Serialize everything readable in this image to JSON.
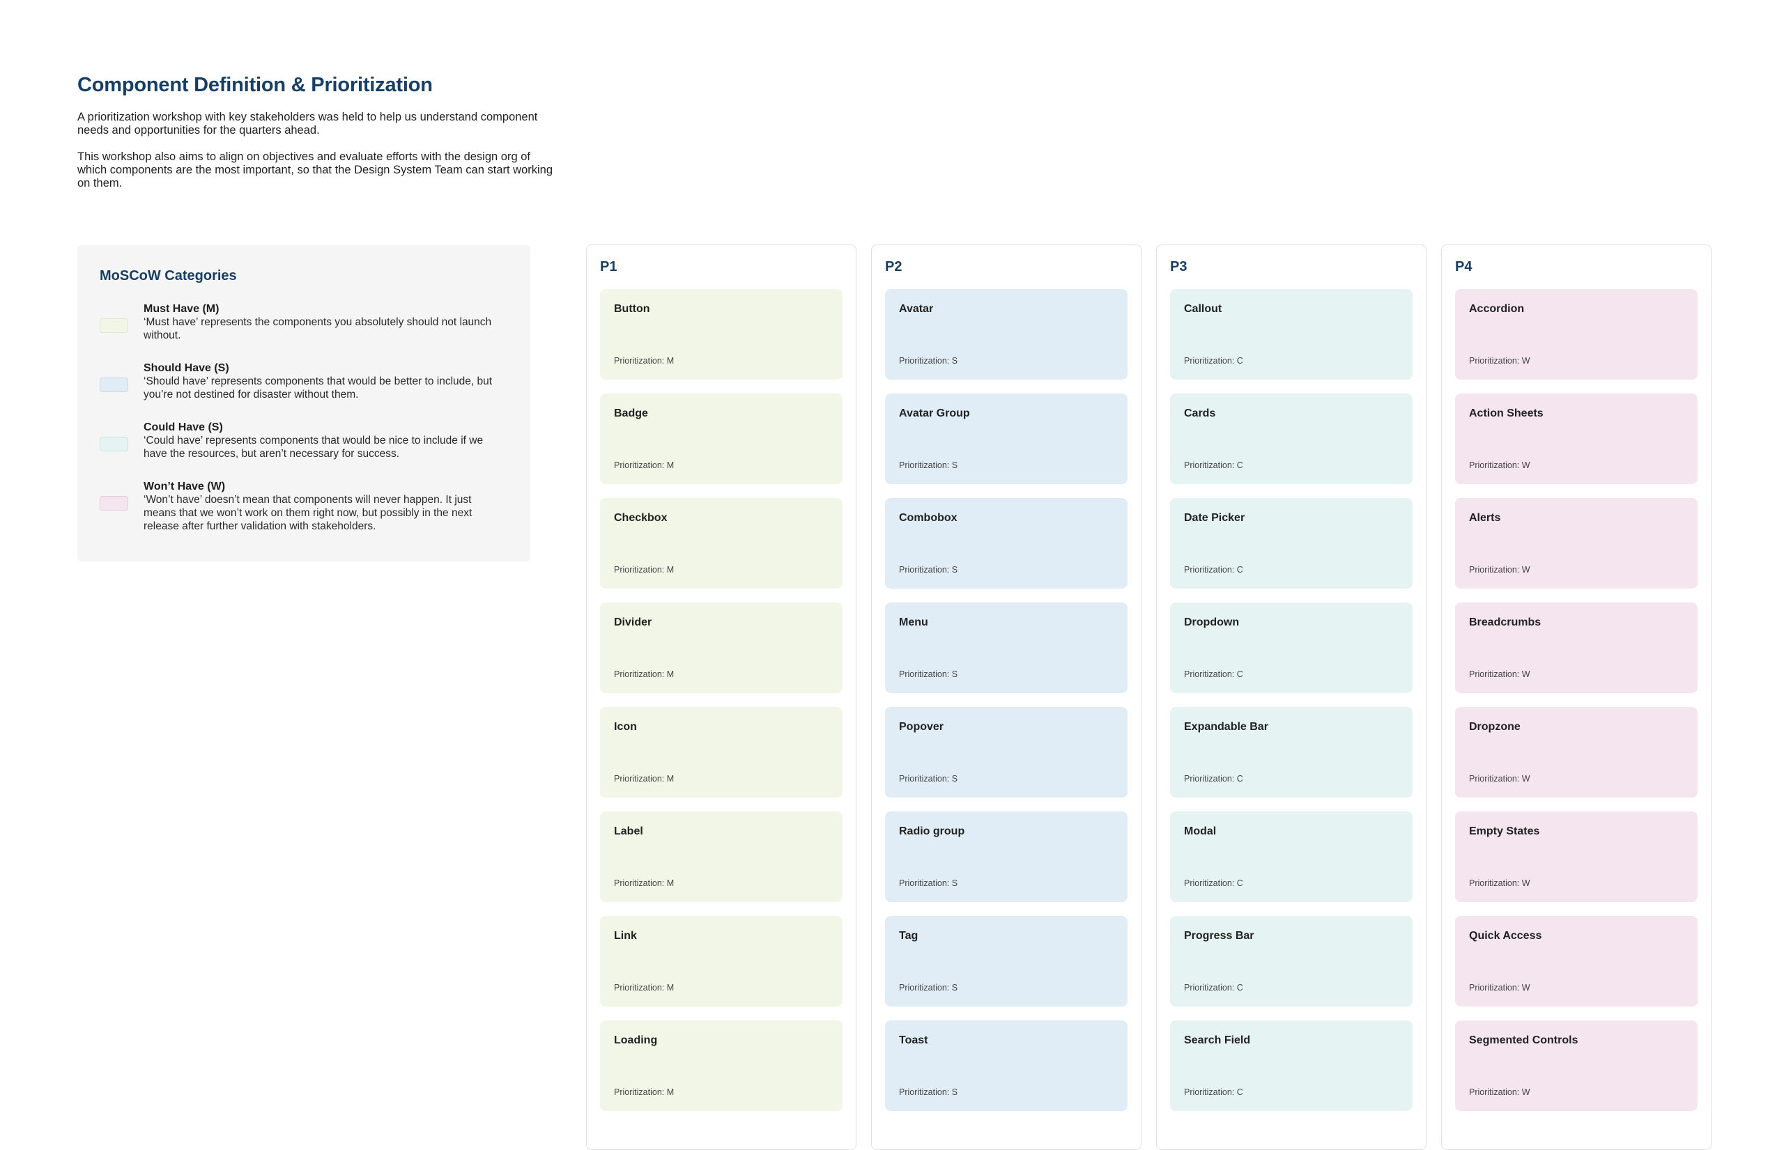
{
  "page": {
    "title": "Component Definition & Prioritization",
    "intro": [
      "A prioritization workshop with key stakeholders was held to help us understand component needs and opportunities for the quarters ahead.",
      "This workshop also aims to align on objectives and evaluate efforts with the design org of which components are the most important, so that the Design System Team can start working on them."
    ]
  },
  "legend": {
    "title": "MoSCoW Categories",
    "items": [
      {
        "name": "Must Have (M)",
        "description": "‘Must have’ represents the components you absolutely should not launch without.",
        "color": "#f2f6e6",
        "border": "#dfe8c8"
      },
      {
        "name": "Should Have (S)",
        "description": "‘Should have’ represents components that would be better to include, but you’re not destined for disaster without them.",
        "color": "#e1edf6",
        "border": "#c8dbeb"
      },
      {
        "name": "Could Have (S)",
        "description": "‘Could have’ represents components that would be nice to include if we have the resources, but aren’t necessary for success.",
        "color": "#e5f4f3",
        "border": "#c9e5e3"
      },
      {
        "name": "Won’t Have (W)",
        "description": "‘Won’t have’ doesn’t mean that components will never happen. It just means that we won’t work on them right now, but possibly in the next release after further validation with stakeholders.",
        "color": "#f4e5ee",
        "border": "#e6cbdb"
      }
    ]
  },
  "columns": [
    {
      "title": "P1",
      "color": "#f2f6e6",
      "cards": [
        {
          "name": "Button",
          "priority": "Prioritization: M"
        },
        {
          "name": "Badge",
          "priority": "Prioritization: M"
        },
        {
          "name": "Checkbox",
          "priority": "Prioritization: M"
        },
        {
          "name": "Divider",
          "priority": "Prioritization: M"
        },
        {
          "name": "Icon",
          "priority": "Prioritization: M"
        },
        {
          "name": "Label",
          "priority": "Prioritization: M"
        },
        {
          "name": "Link",
          "priority": "Prioritization: M"
        },
        {
          "name": "Loading",
          "priority": "Prioritization: M"
        }
      ]
    },
    {
      "title": "P2",
      "color": "#e1edf6",
      "cards": [
        {
          "name": "Avatar",
          "priority": "Prioritization: S"
        },
        {
          "name": "Avatar Group",
          "priority": "Prioritization: S"
        },
        {
          "name": "Combobox",
          "priority": "Prioritization: S"
        },
        {
          "name": "Menu",
          "priority": "Prioritization: S"
        },
        {
          "name": "Popover",
          "priority": "Prioritization: S"
        },
        {
          "name": "Radio group",
          "priority": "Prioritization: S"
        },
        {
          "name": "Tag",
          "priority": "Prioritization: S"
        },
        {
          "name": "Toast",
          "priority": "Prioritization: S"
        }
      ]
    },
    {
      "title": "P3",
      "color": "#e5f4f3",
      "cards": [
        {
          "name": "Callout",
          "priority": "Prioritization: C"
        },
        {
          "name": "Cards",
          "priority": "Prioritization: C"
        },
        {
          "name": "Date Picker",
          "priority": "Prioritization: C"
        },
        {
          "name": "Dropdown",
          "priority": "Prioritization: C"
        },
        {
          "name": "Expandable Bar",
          "priority": "Prioritization: C"
        },
        {
          "name": "Modal",
          "priority": "Prioritization: C"
        },
        {
          "name": "Progress Bar",
          "priority": "Prioritization: C"
        },
        {
          "name": "Search Field",
          "priority": "Prioritization: C"
        }
      ]
    },
    {
      "title": "P4",
      "color": "#f4e5ee",
      "cards": [
        {
          "name": "Accordion",
          "priority": "Prioritization: W"
        },
        {
          "name": "Action Sheets",
          "priority": "Prioritization: W"
        },
        {
          "name": "Alerts",
          "priority": "Prioritization: W"
        },
        {
          "name": "Breadcrumbs",
          "priority": "Prioritization: W"
        },
        {
          "name": "Dropzone",
          "priority": "Prioritization: W"
        },
        {
          "name": "Empty States",
          "priority": "Prioritization: W"
        },
        {
          "name": "Quick Access",
          "priority": "Prioritization: W"
        },
        {
          "name": "Segmented Controls",
          "priority": "Prioritization: W"
        }
      ]
    }
  ]
}
